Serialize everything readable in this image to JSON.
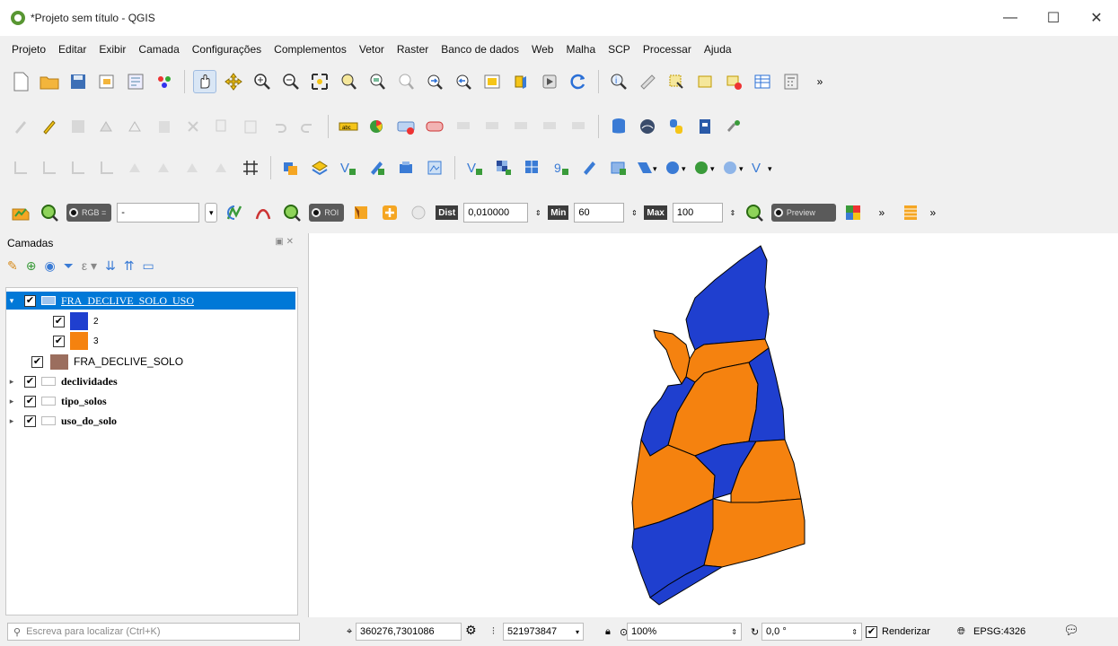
{
  "window": {
    "title": "*Projeto sem título - QGIS",
    "controls": {
      "minimize": "—",
      "maximize": "☐",
      "close": "✕"
    }
  },
  "menu": [
    "Projeto",
    "Editar",
    "Exibir",
    "Camada",
    "Configurações",
    "Complementos",
    "Vetor",
    "Raster",
    "Banco de dados",
    "Web",
    "Malha",
    "SCP",
    "Processar",
    "Ajuda"
  ],
  "scp_toolbar": {
    "rgb_pill": "RGB =",
    "rgb_value": "-",
    "roi_pill": "ROI",
    "dist_label": "Dist",
    "dist_value": "0,010000",
    "min_label": "Min",
    "min_value": "60",
    "max_label": "Max",
    "max_value": "100",
    "preview_pill": "Preview",
    "overflow": "»"
  },
  "layers": {
    "title": "Camadas",
    "items": [
      {
        "name": "FRA_DECLIVE_SOLO_USO",
        "checked": true,
        "selected": true
      },
      {
        "name": "2",
        "checked": true,
        "color": "#1f3fcf"
      },
      {
        "name": "3",
        "checked": true,
        "color": "#f5820f"
      },
      {
        "name": "FRA_DECLIVE_SOLO",
        "checked": true,
        "color": "#9b6e5e"
      },
      {
        "name": "declividades",
        "checked": true
      },
      {
        "name": "tipo_solos",
        "checked": true
      },
      {
        "name": "uso_do_solo",
        "checked": true
      }
    ]
  },
  "map": {
    "colors": {
      "class2": "#1f3fcf",
      "class3": "#f5820f",
      "stroke": "#000000"
    }
  },
  "status": {
    "locator_placeholder": "Escreva para localizar (Ctrl+K)",
    "coordinate": "360276,7301086",
    "scale": "521973847",
    "magnifier": "100%",
    "rotation": "0,0 °",
    "render_label": "Renderizar",
    "crs": "EPSG:4326"
  }
}
